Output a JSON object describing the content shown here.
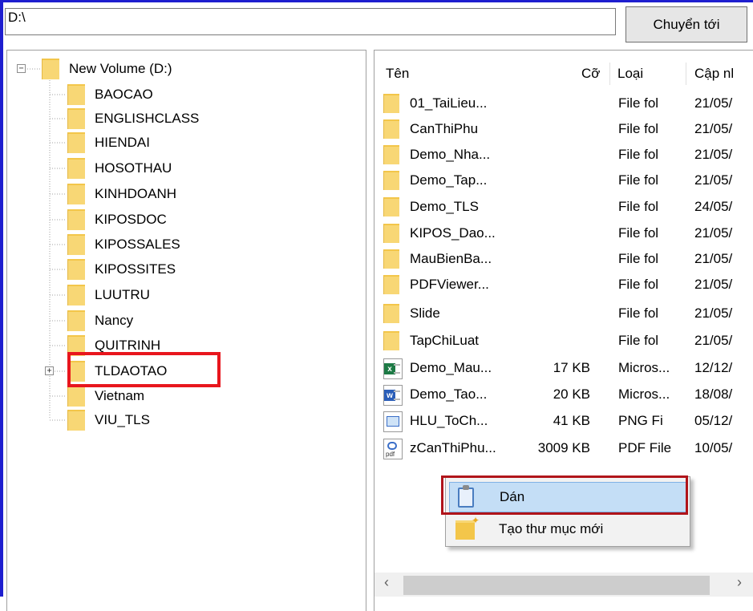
{
  "address_bar": {
    "value": "D:\\"
  },
  "go_button": {
    "label": "Chuyển tới"
  },
  "tree": {
    "root": {
      "label": "New Volume (D:)"
    },
    "children": [
      {
        "label": "BAOCAO"
      },
      {
        "label": "ENGLISHCLASS"
      },
      {
        "label": "HIENDAI"
      },
      {
        "label": "HOSOTHAU"
      },
      {
        "label": "KINHDOANH"
      },
      {
        "label": "KIPOSDOC"
      },
      {
        "label": "KIPOSSALES"
      },
      {
        "label": "KIPOSSITES"
      },
      {
        "label": "LUUTRU"
      },
      {
        "label": "Nancy"
      },
      {
        "label": "QUITRINH"
      },
      {
        "label": "TLDAOTAO"
      },
      {
        "label": "Vietnam"
      },
      {
        "label": "VIU_TLS"
      }
    ]
  },
  "list": {
    "headers": {
      "name": "Tên",
      "size": "Cỡ",
      "type": "Loại",
      "date": "Cập nl"
    },
    "rows": [
      {
        "icon": "folder-icon",
        "name": "01_TaiLieu...",
        "size": "",
        "type": "File fol",
        "date": "21/05/"
      },
      {
        "icon": "folder-icon",
        "name": "CanThiPhu",
        "size": "",
        "type": "File fol",
        "date": "21/05/"
      },
      {
        "icon": "folder-icon",
        "name": "Demo_Nha...",
        "size": "",
        "type": "File fol",
        "date": "21/05/"
      },
      {
        "icon": "folder-icon",
        "name": "Demo_Tap...",
        "size": "",
        "type": "File fol",
        "date": "21/05/"
      },
      {
        "icon": "folder-icon",
        "name": "Demo_TLS",
        "size": "",
        "type": "File fol",
        "date": "24/05/"
      },
      {
        "icon": "folder-icon",
        "name": "KIPOS_Dao...",
        "size": "",
        "type": "File fol",
        "date": "21/05/"
      },
      {
        "icon": "folder-icon",
        "name": "MauBienBa...",
        "size": "",
        "type": "File fol",
        "date": "21/05/"
      },
      {
        "icon": "folder-icon",
        "name": "PDFViewer...",
        "size": "",
        "type": "File fol",
        "date": "21/05/"
      },
      {
        "icon": "folder-icon",
        "name": "Slide",
        "size": "",
        "type": "File fol",
        "date": "21/05/"
      },
      {
        "icon": "folder-icon",
        "name": "TapChiLuat",
        "size": "",
        "type": "File fol",
        "date": "21/05/"
      },
      {
        "icon": "excel-file-icon",
        "name": "Demo_Mau...",
        "size": "17 KB",
        "type": "Micros...",
        "date": "12/12/"
      },
      {
        "icon": "word-file-icon",
        "name": "Demo_Tao...",
        "size": "20 KB",
        "type": "Micros...",
        "date": "18/08/"
      },
      {
        "icon": "png-file-icon",
        "name": "HLU_ToCh...",
        "size": "41 KB",
        "type": "PNG Fi",
        "date": "05/12/"
      },
      {
        "icon": "pdf-file-icon",
        "name": "zCanThiPhu...",
        "size": "3009 KB",
        "type": "PDF File",
        "date": "10/05/"
      }
    ]
  },
  "icons": {
    "excel_tag": "x",
    "word_tag": "w",
    "pdf_tag": "pdf"
  },
  "context_menu": {
    "paste": {
      "label": "Dán"
    },
    "new_folder": {
      "label": "Tạo thư mục mới"
    }
  },
  "scrollbar": {
    "left_arrow": "‹",
    "right_arrow": "›"
  },
  "colors": {
    "frame": "#1e1ecf",
    "highlight": "#e8161d",
    "menu_highlight": "#c4def6",
    "folder": "#f8d775"
  }
}
